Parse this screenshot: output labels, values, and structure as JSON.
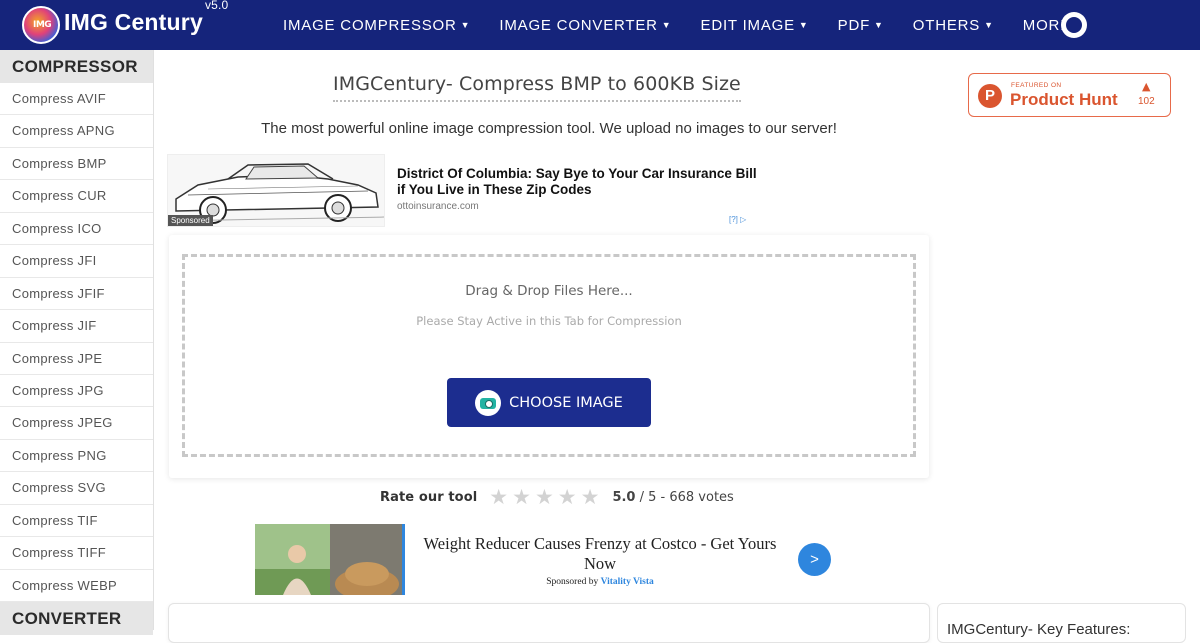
{
  "header": {
    "logo_text": "IMG",
    "brand": "IMG Century",
    "version": "v5.0",
    "nav": [
      {
        "label": "IMAGE COMPRESSOR",
        "icon": "caret-down-icon"
      },
      {
        "label": "IMAGE CONVERTER",
        "icon": "caret-down-icon"
      },
      {
        "label": "EDIT IMAGE",
        "icon": "caret-down-icon"
      },
      {
        "label": "PDF",
        "icon": "caret-down-icon"
      },
      {
        "label": "OTHERS",
        "icon": "caret-down-icon"
      },
      {
        "label": "MORE",
        "icon": "caret-down-icon"
      }
    ],
    "colors": {
      "bar": "#15247b"
    }
  },
  "sidebar": {
    "compressor_heading": "COMPRESSOR",
    "items": [
      "Compress AVIF",
      "Compress APNG",
      "Compress BMP",
      "Compress CUR",
      "Compress ICO",
      "Compress JFI",
      "Compress JFIF",
      "Compress JIF",
      "Compress JPE",
      "Compress JPG",
      "Compress JPEG",
      "Compress PNG",
      "Compress SVG",
      "Compress TIF",
      "Compress TIFF",
      "Compress WEBP"
    ],
    "converter_heading": "CONVERTER"
  },
  "main": {
    "title": "IMGCentury- Compress BMP to 600KB Size",
    "subtitle": "The most powerful online image compression tool. We upload no images to our server!",
    "drop_text": "Drag & Drop Files Here...",
    "drop_hint": "Please Stay Active in this Tab for Compression",
    "choose_label": "CHOOSE IMAGE"
  },
  "product_hunt": {
    "featured": "FEATURED ON",
    "name": "Product Hunt",
    "logo_letter": "P",
    "upvote_icon": "▲",
    "count": "102"
  },
  "ad1": {
    "tag": "Sponsored",
    "title": "District Of Columbia: Say Bye to Your Car Insurance Bill if You Live in These Zip Codes",
    "domain": "ottoinsurance.com",
    "choices": "[?] ▷"
  },
  "rating": {
    "label": "Rate our tool",
    "stars": 5,
    "score": "5.0",
    "rest": "/ 5 - 668 votes"
  },
  "ad2": {
    "title": "Weight Reducer Causes Frenzy at Costco - Get Yours Now",
    "sponsored_prefix": "Sponsored by",
    "sponsor": "Vitality Vista",
    "go": ">"
  },
  "features": {
    "title": "IMGCentury- Key Features:"
  }
}
